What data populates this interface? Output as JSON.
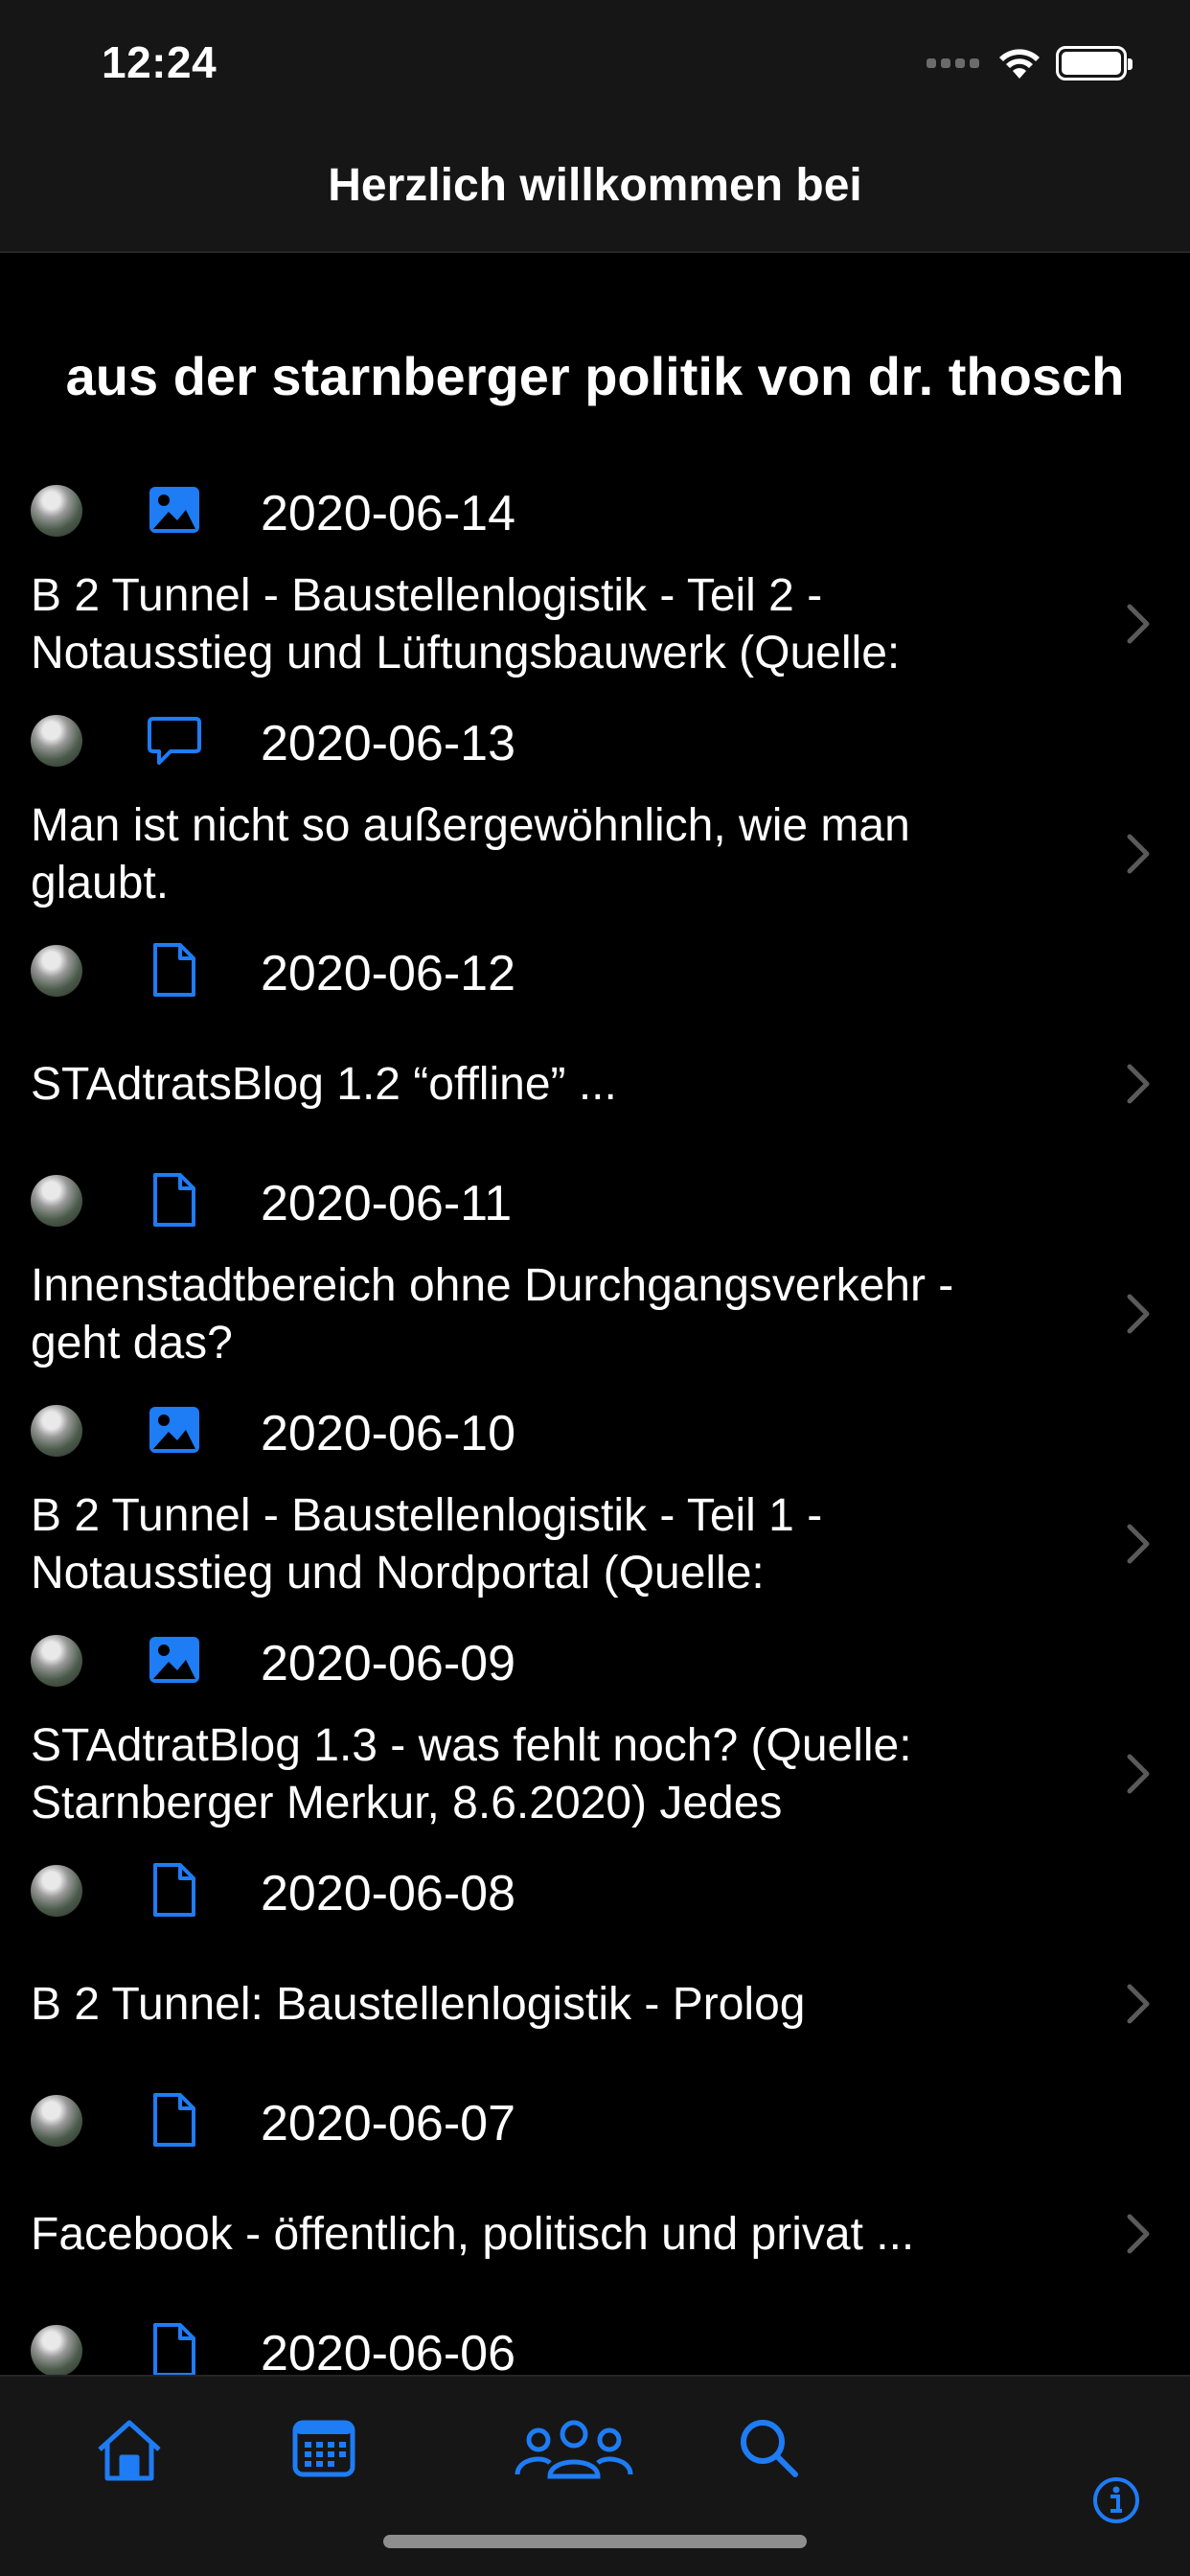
{
  "status_bar": {
    "time": "12:24"
  },
  "nav": {
    "title": "Herzlich willkommen bei"
  },
  "headline": "aus der starnberger politik von dr. thosch",
  "colors": {
    "accent": "#1e7cf5",
    "background": "#000000",
    "bar": "#161616",
    "chevron": "#5a5a5a"
  },
  "posts": [
    {
      "type": "image-icon",
      "date": "2020-06-14",
      "title": "B 2 Tunnel - Baustellenlogistik - Teil 2 - Notausstieg und Lüftungsbauwerk (Quelle:"
    },
    {
      "type": "speech-bubble-icon",
      "date": "2020-06-13",
      "title": "Man ist nicht so außergewöhnlich, wie man glaubt."
    },
    {
      "type": "document-icon",
      "date": "2020-06-12",
      "title": "STAdtratsBlog 1.2 “offline” ..."
    },
    {
      "type": "document-icon",
      "date": "2020-06-11",
      "title": "Innenstadtbereich ohne Durchgangsverkehr - geht das?"
    },
    {
      "type": "image-icon",
      "date": "2020-06-10",
      "title": "B 2 Tunnel - Baustellenlogistik - Teil 1 - Notausstieg und Nordportal (Quelle:"
    },
    {
      "type": "image-icon",
      "date": "2020-06-09",
      "title": "STAdtratBlog 1.3 - was fehlt noch? (Quelle: Starnberger Merkur, 8.6.2020) Jedes"
    },
    {
      "type": "document-icon",
      "date": "2020-06-08",
      "title": "B 2 Tunnel: Baustellenlogistik - Prolog"
    },
    {
      "type": "document-icon",
      "date": "2020-06-07",
      "title": "Facebook - öffentlich, politisch  und privat ..."
    },
    {
      "type": "document-icon",
      "date": "2020-06-06",
      "title": ""
    }
  ],
  "tabs": [
    {
      "name": "tab-home",
      "icon": "house-icon"
    },
    {
      "name": "tab-calendar",
      "icon": "calendar-icon"
    },
    {
      "name": "tab-people",
      "icon": "people-icon"
    },
    {
      "name": "tab-search",
      "icon": "search-icon"
    },
    {
      "name": "info-button",
      "icon": "info-icon"
    }
  ]
}
